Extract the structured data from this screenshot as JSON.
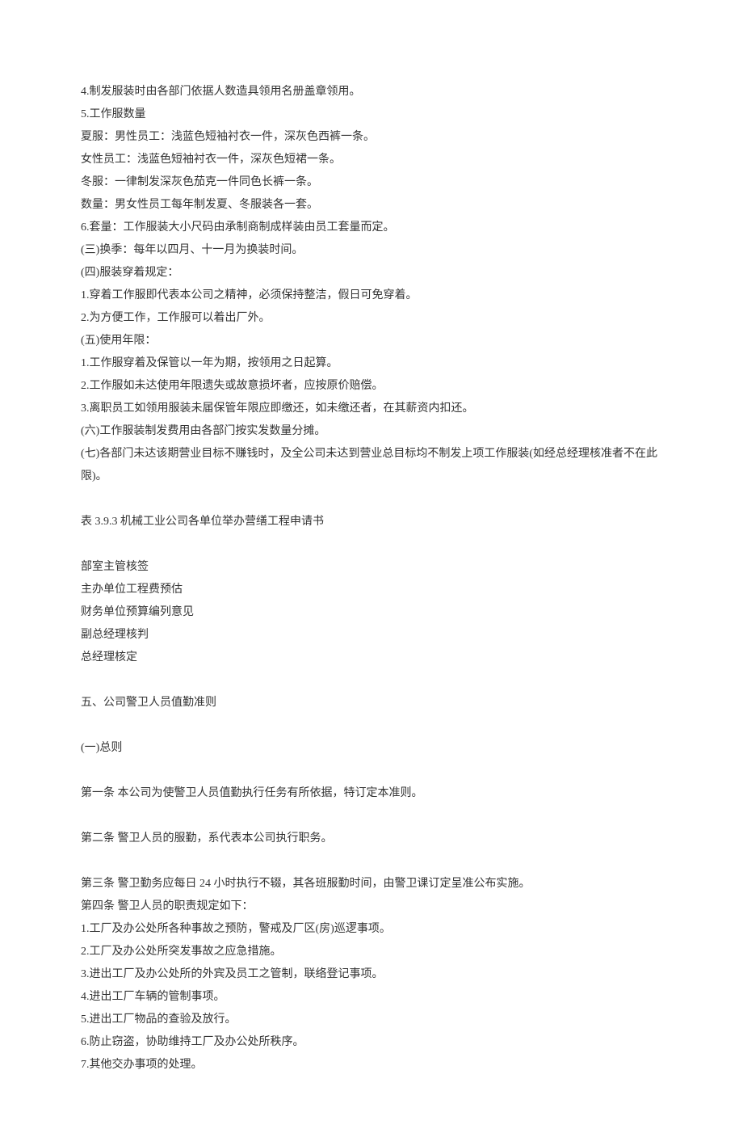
{
  "lines": [
    "4.制发服装时由各部门依据人数造具领用名册盖章领用。",
    "5.工作服数量",
    "夏服：男性员工：浅蓝色短袖衬衣一件，深灰色西裤一条。",
    "女性员工：浅蓝色短袖衬衣一件，深灰色短裙一条。",
    "冬服：一律制发深灰色茄克一件同色长裤一条。",
    "数量：男女性员工每年制发夏、冬服装各一套。",
    "6.套量：工作服装大小尺码由承制商制成样装由员工套量而定。",
    "(三)换季：每年以四月、十一月为换装时间。",
    "(四)服装穿着规定：",
    "1.穿着工作服即代表本公司之精神，必须保持整洁，假日可免穿着。",
    "2.为方便工作，工作服可以着出厂外。",
    "(五)使用年限：",
    "1.工作服穿着及保管以一年为期，按领用之日起算。",
    "2.工作服如未达使用年限遗失或故意损坏者，应按原价赔偿。",
    "3.离职员工如领用服装未届保管年限应即缴还，如未缴还者，在其薪资内扣还。",
    "(六)工作服装制发费用由各部门按实发数量分摊。",
    "(七)各部门未达该期营业目标不赚钱时，及全公司未达到营业总目标均不制发上项工作服装(如经总经理核准者不在此限)。"
  ],
  "table_title": "表 3.9.3 机械工业公司各单位举办营缮工程申请书",
  "table_rows": [
    "部室主管核签",
    "主办单位工程费预估",
    "财务单位预算编列意见",
    "副总经理核判",
    "总经理核定"
  ],
  "section5_title": "五、公司警卫人员值勤准则",
  "sub_heading": "(一)总则",
  "articles": [
    "第一条 本公司为使警卫人员值勤执行任务有所依据，特订定本准则。",
    "第二条 警卫人员的服勤，系代表本公司执行职务。",
    "第三条 警卫勤务应每日 24 小时执行不辍，其各班服勤时间，由警卫课订定呈准公布实施。"
  ],
  "article4": "第四条 警卫人员的职责规定如下：",
  "article4_items": [
    "1.工厂及办公处所各种事故之预防，警戒及厂区(房)巡逻事项。",
    "2.工厂及办公处所突发事故之应急措施。",
    "3.进出工厂及办公处所的外宾及员工之管制，联络登记事项。",
    "4.进出工厂车辆的管制事项。",
    "5.进出工厂物品的查验及放行。",
    "6.防止窃盗，协助维持工厂及办公处所秩序。",
    "7.其他交办事项的处理。"
  ]
}
